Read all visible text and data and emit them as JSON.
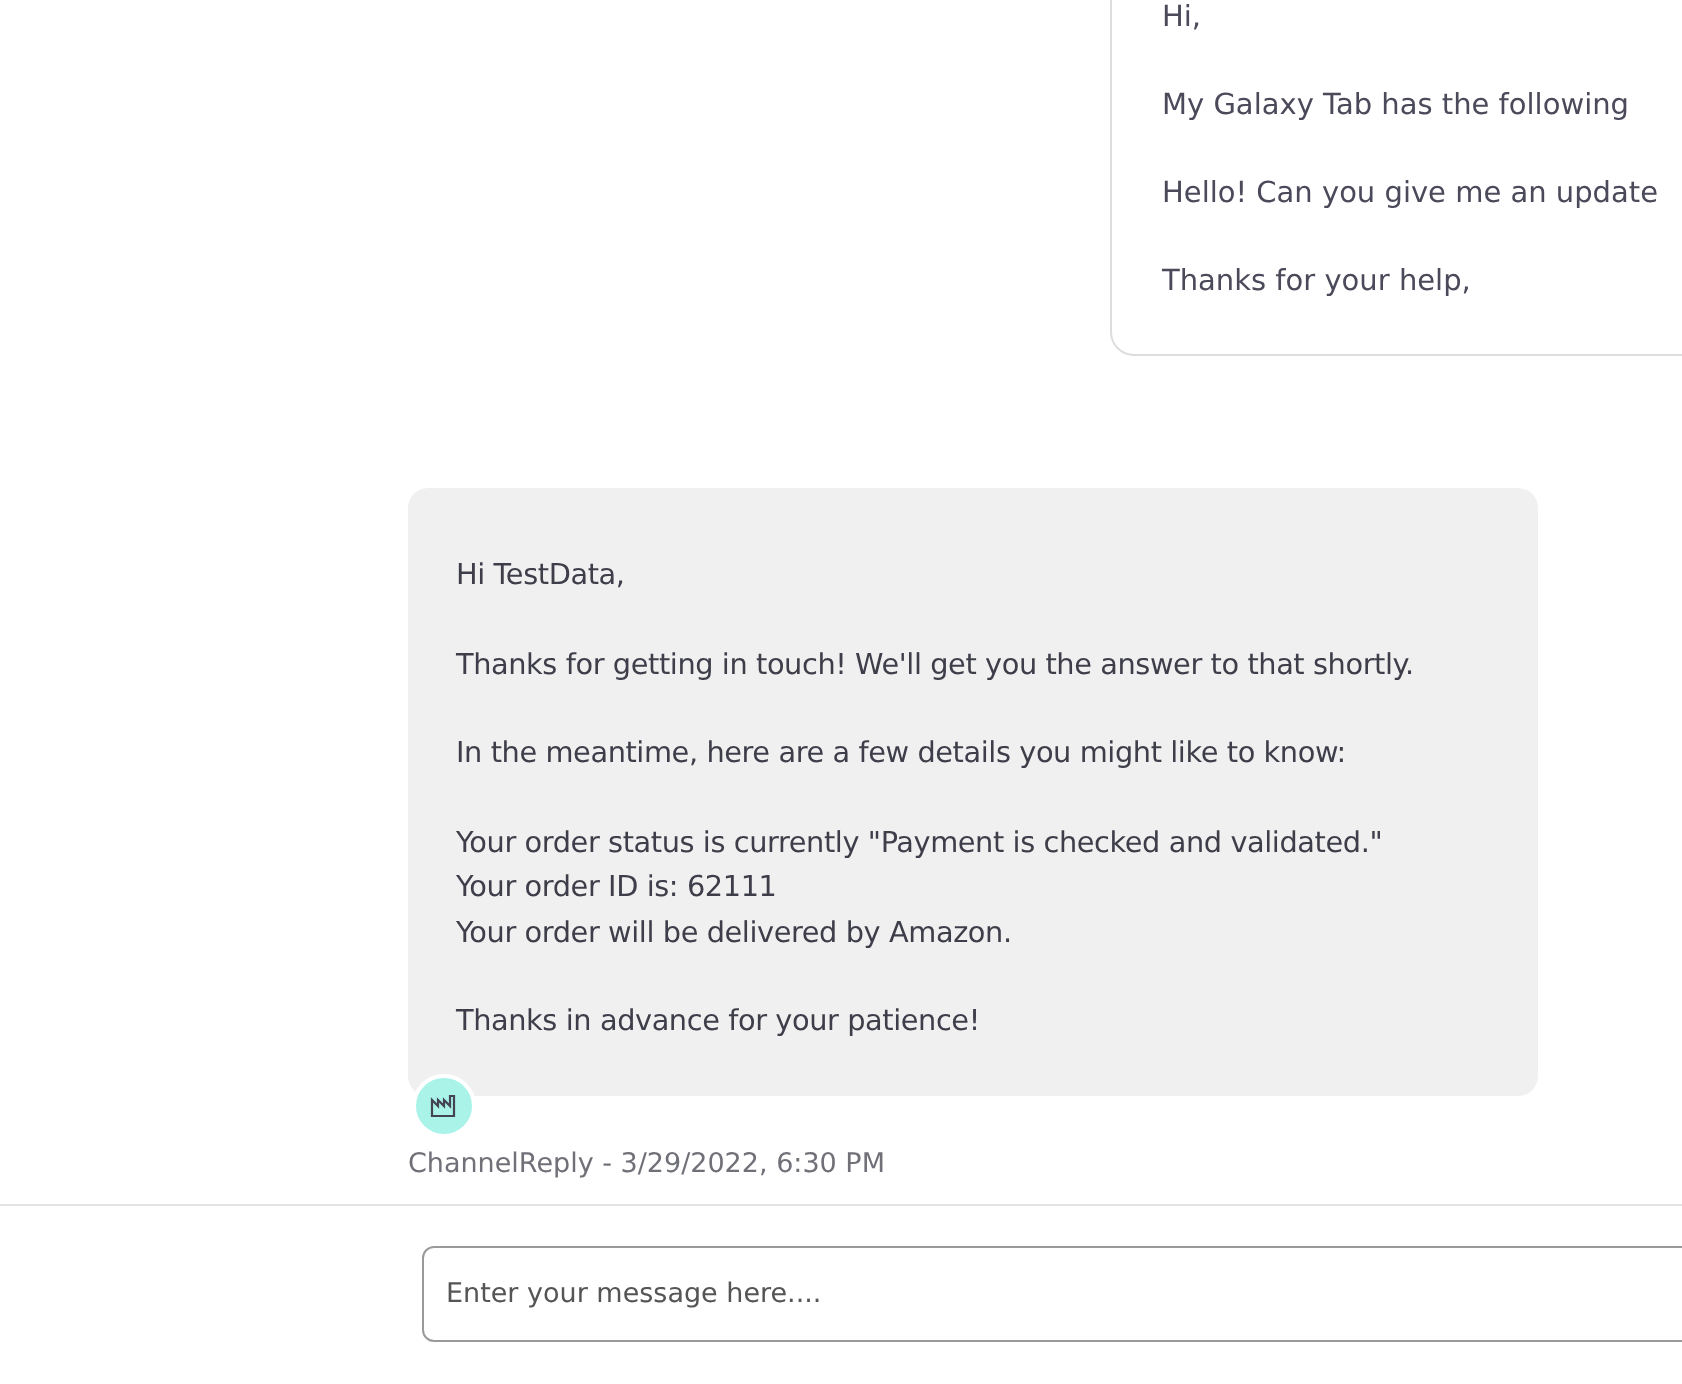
{
  "messages": [
    {
      "kind": "customer",
      "paragraphs": [
        [
          "Hi,"
        ],
        [
          "My Galaxy Tab has the following"
        ],
        [
          "Hello! Can you give me an update"
        ],
        [
          "Thanks for your help,"
        ]
      ]
    },
    {
      "kind": "agent",
      "paragraphs": [
        [
          "Hi TestData,"
        ],
        [
          "Thanks for getting in touch! We'll get you the answer to that shortly."
        ],
        [
          "In the meantime, here are a few details you might like to know:"
        ],
        [
          "Your order status is currently \"Payment is checked and validated.\"",
          "Your order ID is: 62111",
          "Your order will be delivered by Amazon."
        ],
        [
          "Thanks in advance for your patience!"
        ]
      ],
      "meta": "ChannelReply - 3/29/2022, 6:30 PM"
    }
  ],
  "composer": {
    "placeholder": "Enter your message here...."
  }
}
